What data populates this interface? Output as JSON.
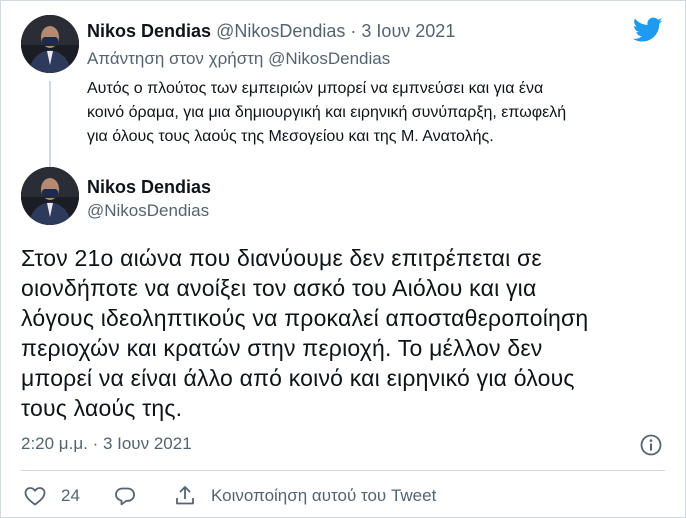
{
  "colors": {
    "accent": "#1d9bf0",
    "muted": "#536471",
    "text": "#0f1419",
    "border": "#cfd9de"
  },
  "parent_tweet": {
    "display_name": "Nikos Dendias",
    "handle": "@NikosDendias",
    "separator": "·",
    "date": "3 Ιουν 2021",
    "reply_prefix": "Απάντηση στον χρήστη",
    "reply_handle": "@NikosDendias",
    "text_lines": [
      "Αυτός ο πλούτος των εμπειριών μπορεί να εμπνεύσει και για ένα",
      "κοινό όραμα, για μια δημιουργική και ειρηνική συνύπαρξη, επωφελή",
      "για όλους τους λαούς της Μεσογείου και της Μ. Ανατολής."
    ]
  },
  "main_tweet": {
    "display_name": "Nikos Dendias",
    "handle": "@NikosDendias",
    "text_lines": [
      "Στον 21ο αιώνα που διανύουμε δεν επιτρέπεται σε",
      "οιονδήποτε να ανοίξει τον ασκό  του Αιόλου και για",
      "λόγους ιδεοληπτικούς να προκαλεί αποσταθεροποίηση",
      "περιοχών και κρατών στην περιοχή. Το μέλλον δεν",
      "μπορεί να είναι άλλο από κοινό και ειρηνικό για όλους",
      "τους λαούς της."
    ],
    "timestamp": "2:20 μ.μ. · 3 Ιουν 2021",
    "like_count": "24",
    "share_label": "Κοινοποίηση αυτού του Tweet"
  },
  "icons": [
    "twitter-bird-icon",
    "info-icon",
    "heart-icon",
    "reply-icon",
    "share-icon"
  ]
}
